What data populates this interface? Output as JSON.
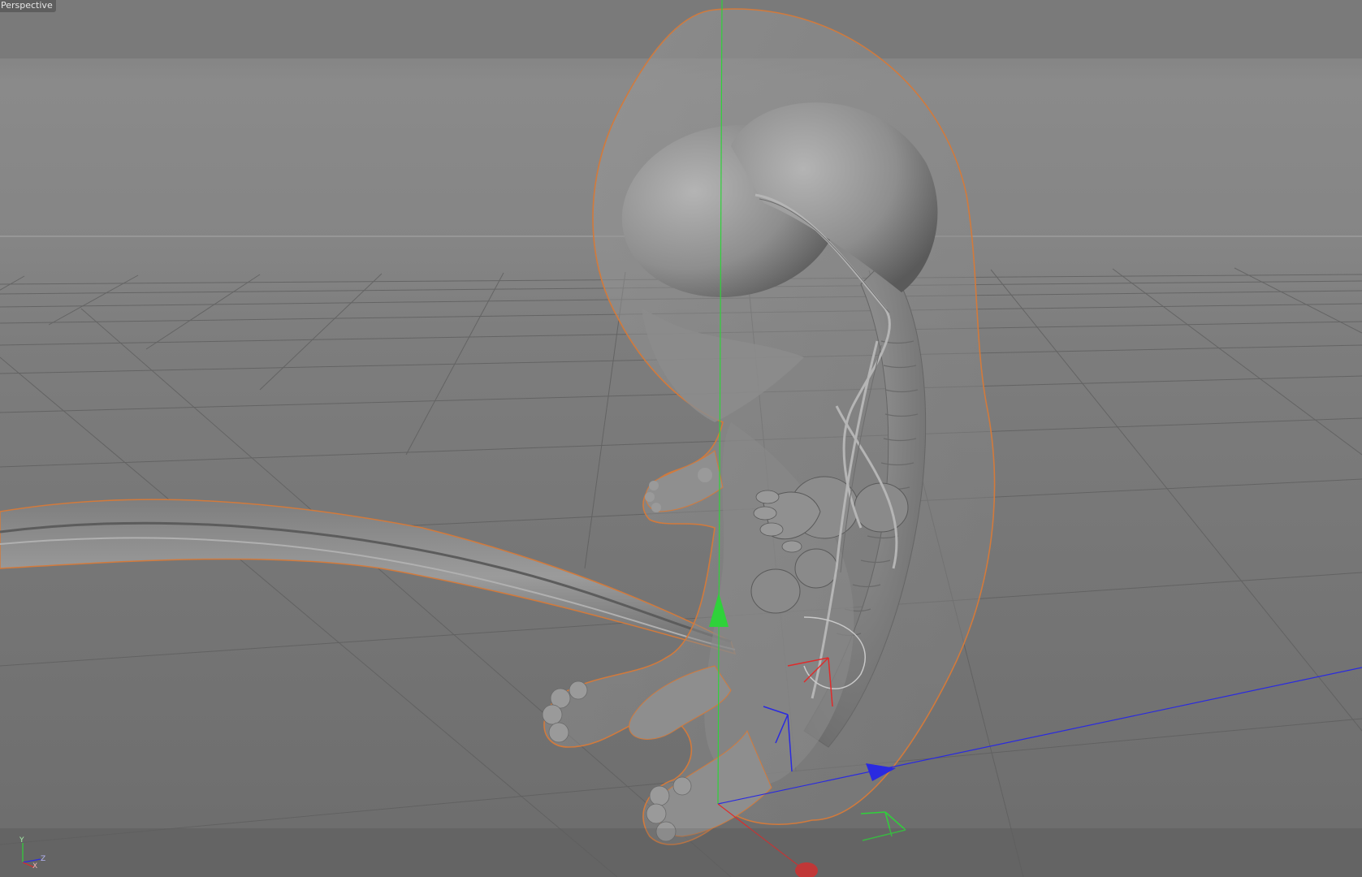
{
  "viewport": {
    "label": "Perspective"
  },
  "orientation_axes": {
    "y": "Y",
    "x": "X",
    "z": "Z"
  },
  "colors": {
    "selection_outline": "#d27a3c",
    "axis_x": "#e02a2a",
    "axis_y": "#2fd23a",
    "axis_z": "#2a2ae0",
    "grid": "#5e5e5e",
    "background": "#7a7a7a"
  }
}
